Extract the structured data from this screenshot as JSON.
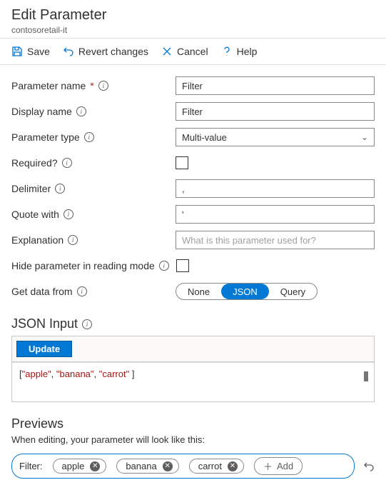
{
  "header": {
    "title": "Edit Parameter",
    "subtitle": "contosoretail-it"
  },
  "toolbar": {
    "save": "Save",
    "revert": "Revert changes",
    "cancel": "Cancel",
    "help": "Help"
  },
  "form": {
    "param_name": {
      "label": "Parameter name",
      "value": "Filter"
    },
    "display_name": {
      "label": "Display name",
      "value": "Filter"
    },
    "param_type": {
      "label": "Parameter type",
      "value": "Multi-value"
    },
    "required": {
      "label": "Required?"
    },
    "delimiter": {
      "label": "Delimiter",
      "value": ","
    },
    "quote_with": {
      "label": "Quote with",
      "value": "'"
    },
    "explanation": {
      "label": "Explanation",
      "placeholder": "What is this parameter used for?"
    },
    "hide_reading": {
      "label": "Hide parameter in reading mode"
    },
    "get_data": {
      "label": "Get data from",
      "options": [
        "None",
        "JSON",
        "Query"
      ],
      "selected": "JSON"
    }
  },
  "json": {
    "title": "JSON Input",
    "update": "Update",
    "tokens": [
      "[",
      "\"apple\"",
      ", ",
      "\"banana\"",
      ", ",
      "\"carrot\"",
      " ]"
    ]
  },
  "previews": {
    "title": "Previews",
    "desc": "When editing, your parameter will look like this:",
    "filter_label": "Filter:",
    "tags": [
      "apple",
      "banana",
      "carrot"
    ],
    "add": "Add"
  }
}
